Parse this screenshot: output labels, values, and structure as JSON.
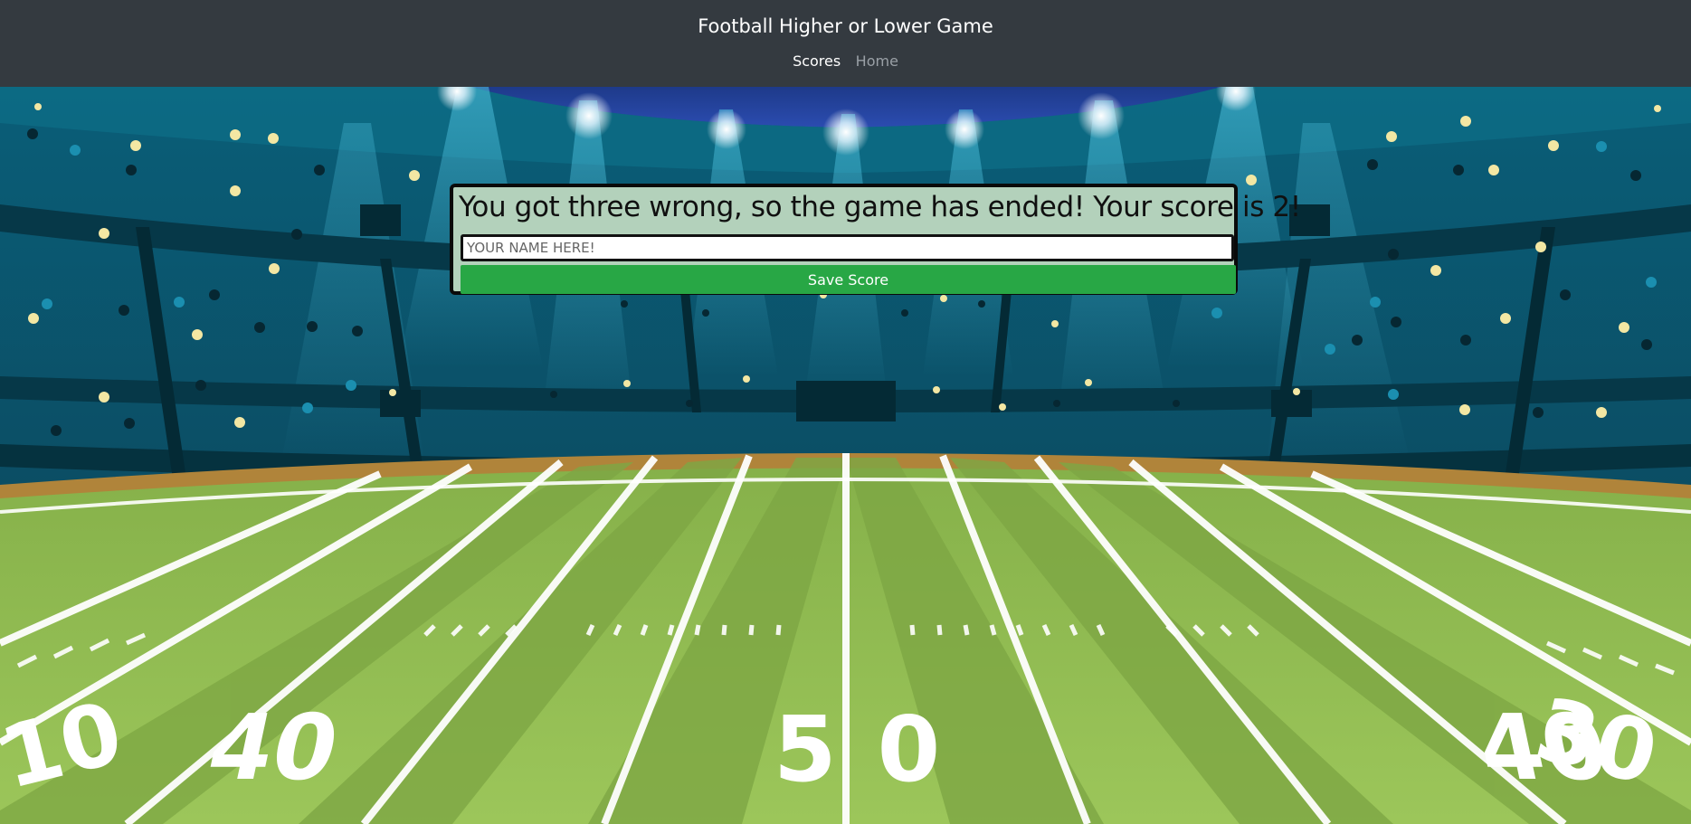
{
  "navbar": {
    "brand": "Football Higher or Lower Game",
    "links": [
      {
        "label": "Scores",
        "active": true
      },
      {
        "label": "Home",
        "active": false
      }
    ]
  },
  "end_game": {
    "message": "You got three wrong, so the game has ended! Your score is 2!",
    "name_placeholder": "YOUR NAME HERE!",
    "name_value": "",
    "save_label": "Save Score"
  },
  "field": {
    "yard_labels": [
      "10",
      "40",
      "50",
      "40",
      "30"
    ]
  },
  "colors": {
    "navbar_bg": "#343a40",
    "panel_bg": "#b3d1bb",
    "save_button": "#28a745",
    "stadium_dark": "#073a4a",
    "field_green": "#8fb84e"
  }
}
